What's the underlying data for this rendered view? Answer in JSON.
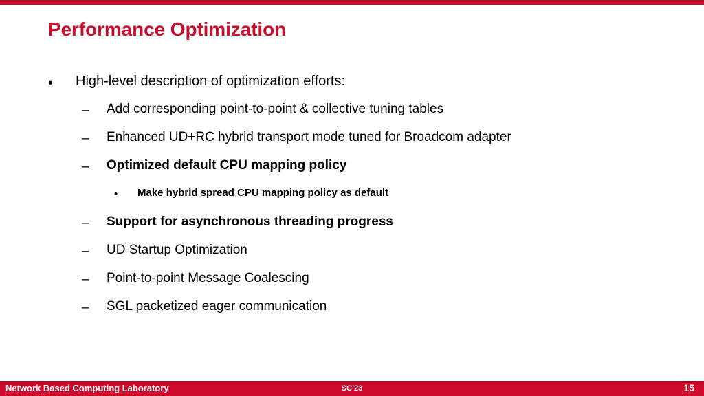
{
  "theme": {
    "accent_color": "#c8102e",
    "bar_color": "#ce0a2d",
    "bar_shade_color": "#ad0b25",
    "text_color": "#000000",
    "background_color": "#ffffff"
  },
  "title": "Performance Optimization",
  "bullets": [
    {
      "level": 1,
      "marker": "•",
      "text": "High-level description of optimization efforts:",
      "bold": false
    },
    {
      "level": 2,
      "marker": "–",
      "text": "Add corresponding point-to-point & collective tuning tables",
      "bold": false
    },
    {
      "level": 2,
      "marker": "–",
      "text": "Enhanced UD+RC hybrid transport mode tuned for Broadcom adapter",
      "bold": false
    },
    {
      "level": 2,
      "marker": "–",
      "text": "Optimized default CPU mapping policy",
      "bold": true
    },
    {
      "level": 3,
      "marker": "•",
      "text": "Make hybrid spread CPU mapping policy as default",
      "bold": true
    },
    {
      "level": 2,
      "marker": "–",
      "text": "Support for asynchronous threading progress",
      "bold": true
    },
    {
      "level": 2,
      "marker": "–",
      "text": "UD Startup Optimization",
      "bold": false
    },
    {
      "level": 2,
      "marker": "–",
      "text": "Point-to-point Message Coalescing",
      "bold": false
    },
    {
      "level": 2,
      "marker": "–",
      "text": "SGL packetized eager communication",
      "bold": false
    }
  ],
  "footer": {
    "organization": "Network Based Computing Laboratory",
    "venue": "SC’23",
    "page_number": "15"
  }
}
